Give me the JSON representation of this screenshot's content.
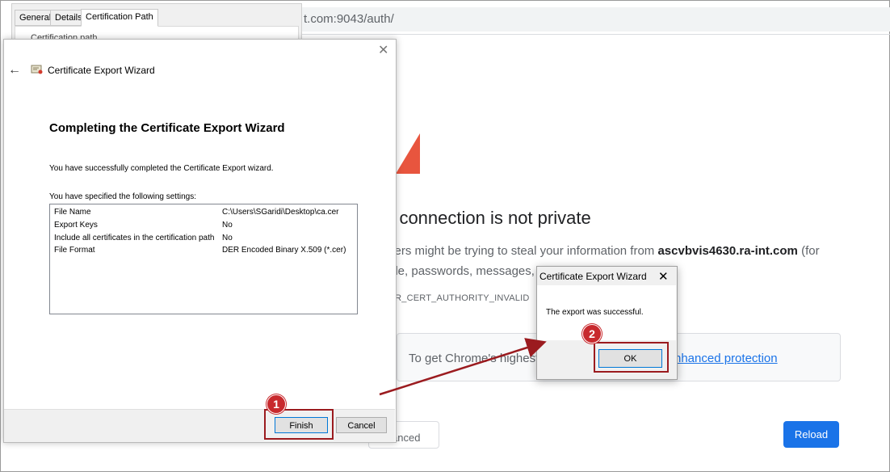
{
  "browser": {
    "address_suffix": "t.com:9043/auth/",
    "heading": "r connection is not private",
    "para1_prefix": "kers might be trying to steal your information from ",
    "para1_host": "ascvbvis4630.ra-int.com",
    "para1_suffix": " (for",
    "para2": "ple, passwords, messages, o",
    "error_code": "RR_CERT_AUTHORITY_INVALID",
    "protection_text": "To get Chrome's highest",
    "protection_link": "nhanced protection",
    "advanced_label": "anced",
    "reload_label": "Reload"
  },
  "cert_props": {
    "tabs": [
      "General",
      "Details",
      "Certification Path"
    ],
    "inner_text": "Certification path"
  },
  "wizard": {
    "title": "Certificate Export Wizard",
    "heading": "Completing the Certificate Export Wizard",
    "success_text": "You have successfully completed the Certificate Export wizard.",
    "specified_text": "You have specified the following settings:",
    "settings": [
      {
        "name": "File Name",
        "value": "C:\\Users\\SGaridi\\Desktop\\ca.cer"
      },
      {
        "name": "Export Keys",
        "value": "No"
      },
      {
        "name": "Include all certificates in the certification path",
        "value": "No"
      },
      {
        "name": "File Format",
        "value": "DER Encoded Binary X.509 (*.cer)"
      }
    ],
    "finish_label": "Finish",
    "cancel_label": "Cancel"
  },
  "dialog": {
    "title": "Certificate Export Wizard",
    "message": "The export was successful.",
    "ok_label": "OK"
  },
  "callouts": [
    "1",
    "2"
  ],
  "colors": {
    "highlight": "#9b1b1f",
    "badge": "#c8292d",
    "chrome_blue": "#1a73e8",
    "warning_red": "#e8553e"
  }
}
